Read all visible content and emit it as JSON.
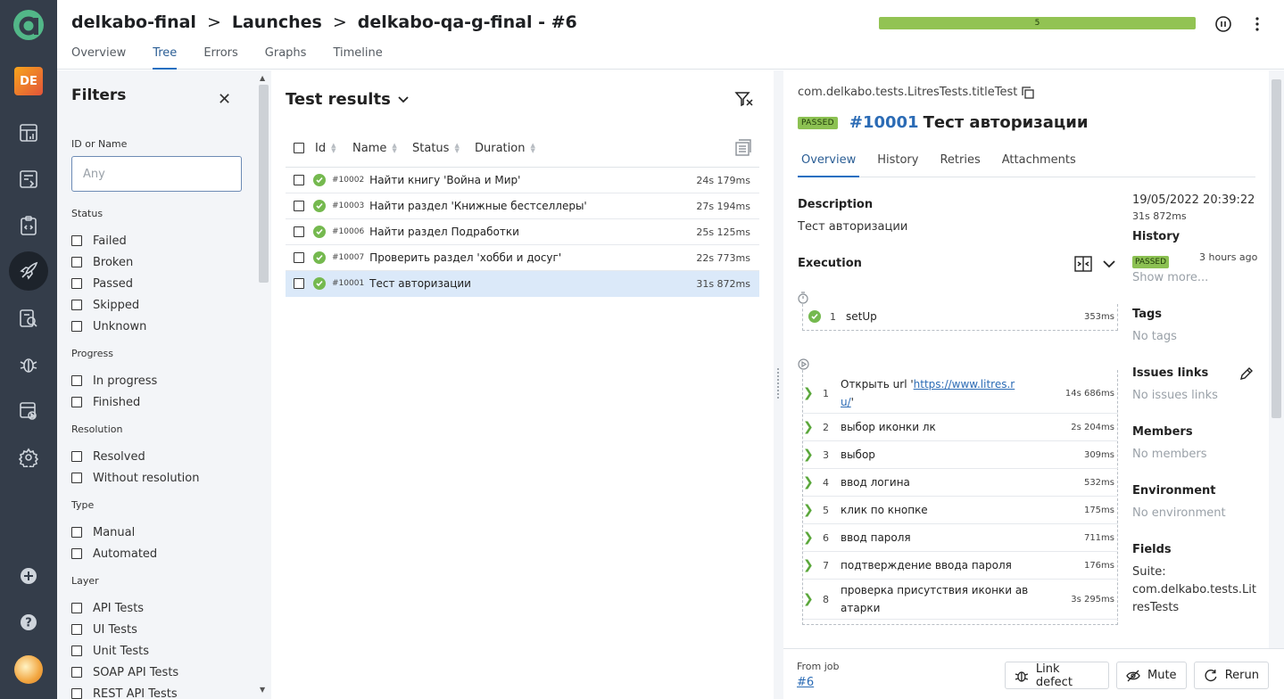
{
  "rail": {
    "project_badge": "DE",
    "icons": [
      "dashboard-icon",
      "launches-list-icon",
      "test-cases-icon",
      "launches-icon",
      "analysis-icon",
      "defects-icon",
      "test-plans-icon",
      "settings-icon"
    ],
    "add_icon": "plus-icon",
    "help_icon": "help-icon"
  },
  "header": {
    "breadcrumbs": [
      "delkabo-final",
      "Launches",
      "delkabo-qa-g-final - #6"
    ],
    "tabs": [
      "Overview",
      "Tree",
      "Errors",
      "Graphs",
      "Timeline"
    ],
    "active_tab": "Tree",
    "status_bar_value": "5",
    "status_bar_color": "#92c353"
  },
  "filters": {
    "title": "Filters",
    "id_label": "ID or Name",
    "id_placeholder": "Any",
    "groups": [
      {
        "title": "Status",
        "items": [
          "Failed",
          "Broken",
          "Passed",
          "Skipped",
          "Unknown"
        ]
      },
      {
        "title": "Progress",
        "items": [
          "In progress",
          "Finished"
        ]
      },
      {
        "title": "Resolution",
        "items": [
          "Resolved",
          "Without resolution"
        ]
      },
      {
        "title": "Type",
        "items": [
          "Manual",
          "Automated"
        ]
      },
      {
        "title": "Layer",
        "items": [
          "API Tests",
          "UI Tests",
          "Unit Tests",
          "SOAP API Tests",
          "REST API Tests"
        ]
      }
    ]
  },
  "results": {
    "title": "Test results",
    "columns": [
      "Id",
      "Name",
      "Status",
      "Duration"
    ],
    "rows": [
      {
        "id": "#10002",
        "name": "Найти книгу 'Война и Мир'",
        "duration": "24s 179ms",
        "selected": false
      },
      {
        "id": "#10003",
        "name": "Найти раздел 'Книжные бестселлеры'",
        "duration": "27s 194ms",
        "selected": false
      },
      {
        "id": "#10006",
        "name": "Найти раздел Подработки",
        "duration": "25s 125ms",
        "selected": false
      },
      {
        "id": "#10007",
        "name": "Проверить раздел 'хобби и досуг'",
        "duration": "22s 773ms",
        "selected": false
      },
      {
        "id": "#10001",
        "name": "Тест авторизации",
        "duration": "31s 872ms",
        "selected": true
      }
    ]
  },
  "detail": {
    "path": "com.delkabo.tests.LitresTests.titleTest",
    "status": "PASSED",
    "number": "#10001",
    "title": "Тест авторизации",
    "tabs": [
      "Overview",
      "History",
      "Retries",
      "Attachments"
    ],
    "description_label": "Description",
    "description": "Тест авторизации",
    "execution_label": "Execution",
    "setup": {
      "n": "1",
      "name": "setUp",
      "duration": "353ms"
    },
    "steps": [
      {
        "n": "1",
        "name_prefix": "Открыть url '",
        "link_line1": "https://www.litres.r",
        "link_line2": "u/",
        "name_suffix": "'",
        "duration": "14s 686ms"
      },
      {
        "n": "2",
        "name": "выбор иконки лк",
        "duration": "2s 204ms"
      },
      {
        "n": "3",
        "name": "выбор",
        "duration": "309ms"
      },
      {
        "n": "4",
        "name": "ввод логина",
        "duration": "532ms"
      },
      {
        "n": "5",
        "name": "клик по кнопке",
        "duration": "175ms"
      },
      {
        "n": "6",
        "name": "ввод пароля",
        "duration": "711ms"
      },
      {
        "n": "7",
        "name": "подтверждение ввода пароля",
        "duration": "176ms"
      },
      {
        "n": "8",
        "name_line1": "проверка присутствия иконки ав",
        "name_line2": "атарки",
        "duration": "3s 295ms"
      }
    ],
    "date": "19/05/2022 20:39:22",
    "total_duration": "31s 872ms",
    "history_label": "History",
    "history_status": "PASSED",
    "history_time": "3 hours ago",
    "show_more": "Show more...",
    "tags_label": "Tags",
    "tags_value": "No tags",
    "issues_label": "Issues links",
    "issues_value": "No issues links",
    "members_label": "Members",
    "members_value": "No members",
    "env_label": "Environment",
    "env_value": "No environment",
    "fields_label": "Fields",
    "suite_label": "Suite:",
    "suite_line1": "com.delkabo.tests.Lit",
    "suite_line2": "resTests",
    "from_job_label": "From job",
    "from_job_value": "#6",
    "buttons": {
      "link_defect": "Link defect",
      "mute": "Mute",
      "rerun": "Rerun"
    }
  }
}
